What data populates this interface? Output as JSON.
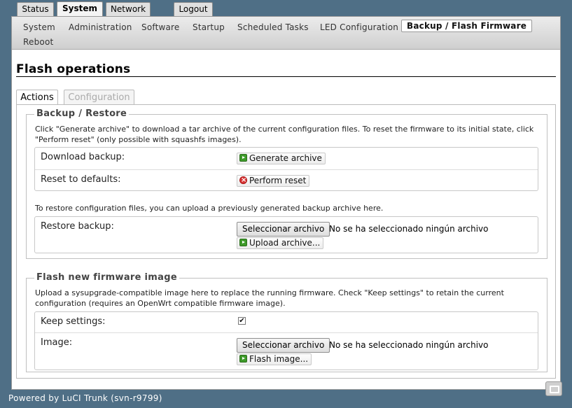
{
  "top_tabs": [
    "Status",
    "System",
    "Network",
    "Logout"
  ],
  "submenu": {
    "items": [
      "System",
      "Administration",
      "Software",
      "Startup",
      "Scheduled Tasks",
      "LED Configuration",
      "Backup / Flash Firmware",
      "Reboot"
    ]
  },
  "page": {
    "title": "Flash operations",
    "tabs": [
      "Actions",
      "Configuration"
    ]
  },
  "backup": {
    "legend": "Backup / Restore",
    "description": "Click \"Generate archive\" to download a tar archive of the current configuration files. To reset the firmware to its initial state, click \"Perform reset\" (only possible with squashfs images).",
    "download_label": "Download backup:",
    "generate_button": "Generate archive",
    "reset_label": "Reset to defaults:",
    "reset_button": "Perform reset",
    "restore_description": "To restore configuration files, you can upload a previously generated backup archive here.",
    "restore_label": "Restore backup:",
    "choose_file_button": "Seleccionar archivo",
    "file_status": "No se ha seleccionado ningún archivo",
    "upload_button": "Upload archive..."
  },
  "flash": {
    "legend": "Flash new firmware image",
    "description": "Upload a sysupgrade-compatible image here to replace the running firmware. Check \"Keep settings\" to retain the current configuration (requires an OpenWrt compatible firmware image).",
    "keep_label": "Keep settings:",
    "keep_checked": true,
    "image_label": "Image:",
    "choose_file_button": "Seleccionar archivo",
    "file_status": "No se ha seleccionado ningún archivo",
    "flash_button": "Flash image..."
  },
  "footer": "Powered by LuCI Trunk (svn-r9799)",
  "icons": [
    "run-icon",
    "reset-icon",
    "checkmark-icon",
    "window-corner-icon"
  ],
  "colors": {
    "background": "#4f6f86",
    "panel": "#ffffff",
    "icon_green": "#3e9a2a",
    "icon_red": "#d93636"
  }
}
